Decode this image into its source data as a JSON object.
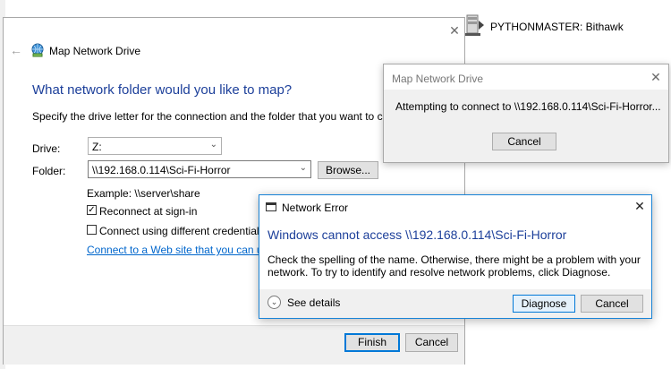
{
  "background": {
    "network_location_label": "PYTHONMASTER: Bithawk"
  },
  "wizard": {
    "title": "Map Network Drive",
    "heading": "What network folder would you like to map?",
    "instructions": "Specify the drive letter for the connection and the folder that you want to connect to:",
    "drive_label": "Drive:",
    "drive_value": "Z:",
    "folder_label": "Folder:",
    "folder_value": "\\\\192.168.0.114\\Sci-Fi-Horror",
    "browse_label": "Browse...",
    "example": "Example: \\\\server\\share",
    "reconnect_label": "Reconnect at sign-in",
    "reconnect_checked": true,
    "different_credentials_label": "Connect using different credentials",
    "different_credentials_checked": false,
    "web_link": "Connect to a Web site that you can use to st",
    "finish_label": "Finish",
    "cancel_label": "Cancel"
  },
  "connect_dialog": {
    "title": "Map Network Drive",
    "message": "Attempting to connect to \\\\192.168.0.114\\Sci-Fi-Horror...",
    "cancel_label": "Cancel"
  },
  "error_dialog": {
    "title": "Network Error",
    "heading": "Windows cannot access \\\\192.168.0.114\\Sci-Fi-Horror",
    "body": "Check the spelling of the name. Otherwise, there might be a problem with your network. To try to identify and resolve network problems, click Diagnose.",
    "details_label": "See details",
    "diagnose_label": "Diagnose",
    "cancel_label": "Cancel"
  },
  "icons": {
    "close": "close-icon",
    "back": "back-arrow-icon",
    "network_drive": "network-drive-icon",
    "network_location": "network-location-icon",
    "expand": "chevron-down-icon",
    "window": "window-icon"
  },
  "colors": {
    "heading_blue": "#1c3f9a",
    "link_blue": "#0066cc",
    "accent": "#0078d7"
  }
}
